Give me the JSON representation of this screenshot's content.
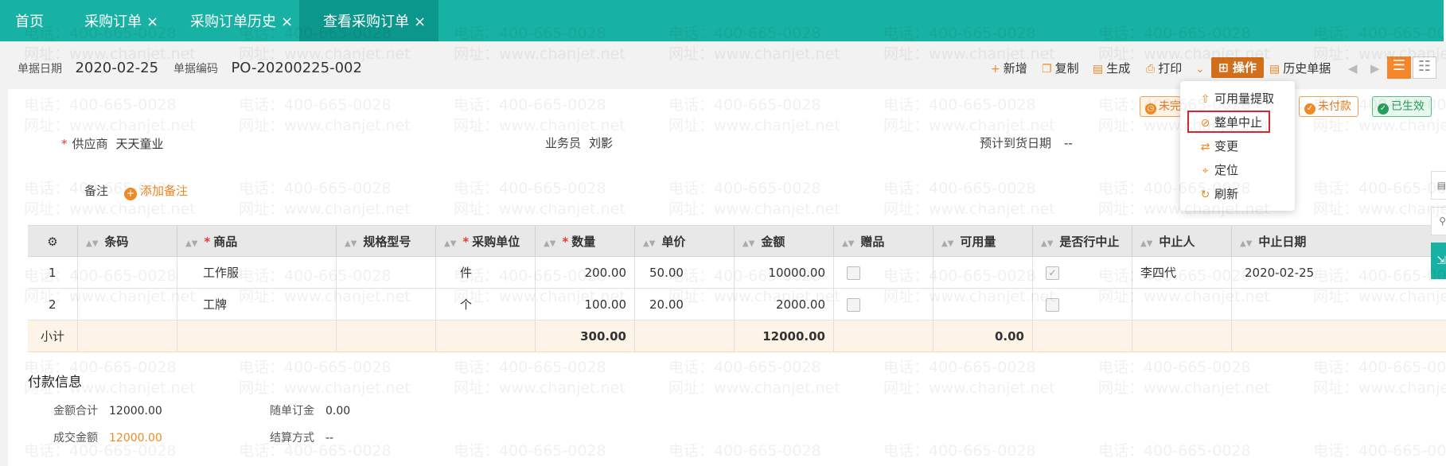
{
  "tabs": [
    {
      "label": "首页",
      "closable": false,
      "active": false
    },
    {
      "label": "采购订单",
      "closable": true,
      "active": false
    },
    {
      "label": "采购订单历史",
      "closable": true,
      "active": false
    },
    {
      "label": "查看采购订单",
      "closable": true,
      "active": true
    }
  ],
  "tab_close_glyph": "×",
  "header": {
    "date_label": "单据日期",
    "date_value": "2020-02-25",
    "code_label": "单据编码",
    "code_value": "PO-20200225-002"
  },
  "toolbar": {
    "add": "新增",
    "copy": "复制",
    "generate": "生成",
    "print": "打印",
    "operate": "操作",
    "history": "历史单据"
  },
  "status_badges": {
    "partial": "未完",
    "unpaid": "未付款",
    "effective": "已生效"
  },
  "form": {
    "supplier_label": "供应商",
    "supplier_value": "天天童业",
    "salesman_label": "业务员",
    "salesman_value": "刘影",
    "eta_label": "预计到货日期",
    "eta_value": "--",
    "note_label": "备注",
    "add_note": "添加备注"
  },
  "table": {
    "columns": [
      {
        "label": "",
        "required": false,
        "sortable": false
      },
      {
        "label": "条码",
        "required": false,
        "sortable": true
      },
      {
        "label": "商品",
        "required": true,
        "sortable": true
      },
      {
        "label": "规格型号",
        "required": false,
        "sortable": true
      },
      {
        "label": "采购单位",
        "required": true,
        "sortable": true
      },
      {
        "label": "数量",
        "required": true,
        "sortable": true
      },
      {
        "label": "单价",
        "required": false,
        "sortable": true
      },
      {
        "label": "金额",
        "required": false,
        "sortable": true
      },
      {
        "label": "赠品",
        "required": false,
        "sortable": true
      },
      {
        "label": "可用量",
        "required": false,
        "sortable": true
      },
      {
        "label": "是否行中止",
        "required": false,
        "sortable": true
      },
      {
        "label": "中止人",
        "required": false,
        "sortable": true
      },
      {
        "label": "中止日期",
        "required": false,
        "sortable": true
      }
    ],
    "rows": [
      {
        "index": "1",
        "barcode": "",
        "product": "工作服",
        "spec": "",
        "unit": "件",
        "qty": "200.00",
        "price": "50.00",
        "amount": "10000.00",
        "gift": false,
        "available": "",
        "line_stopped": true,
        "stopper": "李四代",
        "stop_date": "2020-02-25"
      },
      {
        "index": "2",
        "barcode": "",
        "product": "工牌",
        "spec": "",
        "unit": "个",
        "qty": "100.00",
        "price": "20.00",
        "amount": "2000.00",
        "gift": false,
        "available": "",
        "line_stopped": false,
        "stopper": "",
        "stop_date": ""
      }
    ],
    "subtotal": {
      "label": "小计",
      "qty": "300.00",
      "amount": "12000.00",
      "available": "0.00"
    }
  },
  "payment": {
    "title": "付款信息",
    "total_label": "金额合计",
    "total_value": "12000.00",
    "deposit_label": "随单订金",
    "deposit_value": "0.00",
    "deal_label": "成交金额",
    "deal_value": "12000.00",
    "settle_label": "结算方式",
    "settle_value": "--"
  },
  "dropdown": {
    "items": [
      {
        "label": "可用量提取",
        "icon": "upload-circle-icon"
      },
      {
        "label": "整单中止",
        "icon": "forbidden-icon"
      },
      {
        "label": "变更",
        "icon": "swap-icon"
      },
      {
        "label": "定位",
        "icon": "location-icon"
      },
      {
        "label": "刷新",
        "icon": "refresh-icon"
      }
    ]
  },
  "watermark": {
    "phone": "电话：400-665-0028",
    "site": "网址：www.chanjet.net"
  },
  "colors": {
    "tab_bar": "#18b2a4",
    "tab_active": "#0b978b",
    "accent": "#f08a24",
    "operate_button": "#d26f1d",
    "highlight_border": "#d9242d",
    "success": "#2a9d5c"
  }
}
